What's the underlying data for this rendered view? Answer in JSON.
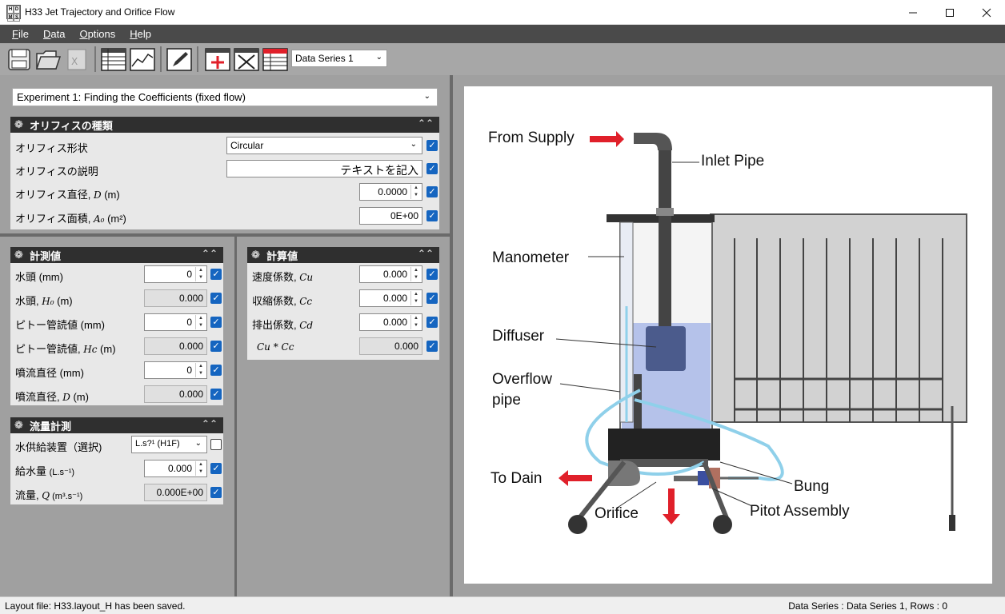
{
  "window": {
    "title": "H33 Jet Trajectory and Orifice Flow",
    "icon_letters": [
      "H",
      "D",
      "M",
      "S"
    ]
  },
  "menu": [
    {
      "label": "File",
      "key": "F",
      "rest": "ile"
    },
    {
      "label": "Data",
      "key": "D",
      "rest": "ata"
    },
    {
      "label": "Options",
      "key": "O",
      "rest": "ptions"
    },
    {
      "label": "Help",
      "key": "H",
      "rest": "elp"
    }
  ],
  "toolbar": {
    "series_selected": "Data Series 1"
  },
  "experiment": {
    "selected": "Experiment 1: Finding the Coefficients (fixed flow)"
  },
  "orifice_panel": {
    "title": "オリフィスの種類",
    "rows": [
      {
        "label": "オリフィス形状",
        "value": "Circular",
        "checked": true
      },
      {
        "label": "オリフィスの説明",
        "value": "テキストを記入",
        "checked": true
      },
      {
        "label_text": "オリフィス直径, ",
        "label_sym": "D",
        "label_unit": " (m)",
        "value": "0.0000",
        "checked": true
      },
      {
        "label_text": "オリフィス面積, ",
        "label_sym": "A₀",
        "label_unit": " (m²)",
        "value": "0E+00",
        "checked": true
      }
    ]
  },
  "measure_panel": {
    "title": "計測値",
    "rows": [
      {
        "label_text": "水頭 ",
        "label_sym": "",
        "label_unit": "(mm)",
        "value": "0",
        "checked": true
      },
      {
        "label_text": "水頭, ",
        "label_sym": "H₀",
        "label_unit": " (m)",
        "value": "0.000",
        "checked": true
      },
      {
        "label_text": "ピトー管読値 ",
        "label_sym": "",
        "label_unit": "(mm)",
        "value": "0",
        "checked": true
      },
      {
        "label_text": "ピトー管読値, ",
        "label_sym": "Hc",
        "label_unit": " (m)",
        "value": "0.000",
        "checked": true
      },
      {
        "label_text": "噴流直径 ",
        "label_sym": "",
        "label_unit": "(mm)",
        "value": "0",
        "checked": true
      },
      {
        "label_text": "噴流直径, ",
        "label_sym": "D",
        "label_unit": " (m)",
        "value": "0.000",
        "checked": true
      }
    ]
  },
  "flow_panel": {
    "title": "流量計測",
    "rows": [
      {
        "label": "水供給装置（選択)",
        "value": "L.s?¹ (H1F)",
        "checked": false
      },
      {
        "label_text": "給水量 ",
        "label_sym": "",
        "label_unit": "(L.s⁻¹)",
        "value": "0.000",
        "checked": true
      },
      {
        "label_text": "流量, ",
        "label_sym": "Q",
        "label_unit": " (m³.s⁻¹)",
        "value": "0.000E+00",
        "checked": true
      }
    ]
  },
  "calc_panel": {
    "title": "計算値",
    "rows": [
      {
        "label_text": "速度係数, ",
        "label_sym": "Cu",
        "value": "0.000",
        "checked": true
      },
      {
        "label_text": "収縮係数, ",
        "label_sym": "Cc",
        "value": "0.000",
        "checked": true
      },
      {
        "label_text": "排出係数, ",
        "label_sym": "Cd",
        "value": "0.000",
        "checked": true
      },
      {
        "label_text": "",
        "label_sym": "Cu * Cc",
        "value": "0.000",
        "checked": true
      }
    ]
  },
  "diagram": {
    "labels": {
      "from_supply": "From Supply",
      "inlet_pipe": "Inlet Pipe",
      "manometer": "Manometer",
      "diffuser": "Diffuser",
      "overflow1": "Overflow",
      "overflow2": "pipe",
      "to_dain": "To Dain",
      "orifice": "Orifice",
      "bung": "Bung",
      "pitot": "Pitot Assembly"
    },
    "colors": {
      "water": "#a9b8e8",
      "arrow": "#e0202a",
      "tube": "#8fd0ea"
    }
  },
  "status": {
    "left": "Layout file: H33.layout_H has been saved.",
    "right": "Data Series : Data Series 1,  Rows : 0"
  }
}
